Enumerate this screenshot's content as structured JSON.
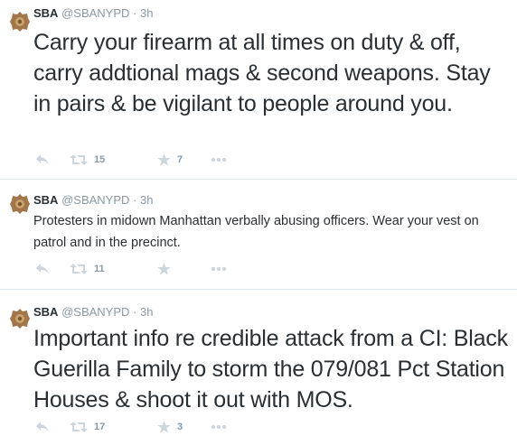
{
  "tweets": [
    {
      "author_name": "SBA",
      "author_handle": "@SBANYPD",
      "separator": "·",
      "time": "3h",
      "text": "Carry your firearm at all times on duty & off, carry addtional mags & second weapons. Stay in pairs & be vigilant to people around you.",
      "retweets": "15",
      "favorites": "7"
    },
    {
      "author_name": "SBA",
      "author_handle": "@SBANYPD",
      "separator": "·",
      "time": "3h",
      "text": "Protesters in midown Manhattan verbally abusing officers.  Wear your vest on patrol and in the precinct.",
      "retweets": "11",
      "favorites": ""
    },
    {
      "author_name": "SBA",
      "author_handle": "@SBANYPD",
      "separator": "·",
      "time": "3h",
      "text": "Important info re credible attack from a CI: Black Guerilla Family to storm the 079/081 Pct Station Houses & shoot it out with MOS.",
      "retweets": "17",
      "favorites": "3"
    }
  ],
  "icons": {
    "reply": "reply-icon",
    "retweet": "retweet-icon",
    "favorite": "star-icon",
    "more": "more-icon",
    "avatar": "police-badge-icon"
  },
  "colors": {
    "text": "#292f33",
    "secondary": "#8899a6",
    "icon": "#ccd6dd",
    "divider": "#e1e8ed",
    "badge": "#a0764a"
  }
}
